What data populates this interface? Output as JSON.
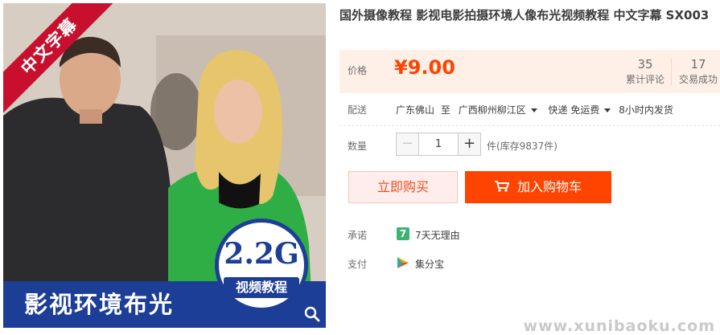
{
  "product": {
    "title": "国外摄像教程 影视电影拍摄环境人像布光视频教程 中文字幕 SX003",
    "image": {
      "ribbon_text": "中文字幕",
      "badge_size": "2.2G",
      "badge_label": "视频教程",
      "bottom_title": "影视环境布光"
    }
  },
  "price": {
    "label": "价格",
    "value": "¥9.00",
    "reviews_count": "35",
    "reviews_label": "累计评论",
    "sales_count": "17",
    "sales_label": "交易成功"
  },
  "shipping": {
    "label": "配送",
    "origin": "广东佛山",
    "to": "至",
    "destination": "广西柳州柳江区",
    "method": "快递 免运费",
    "dispatch": "8小时内发货"
  },
  "quantity": {
    "label": "数量",
    "minus": "−",
    "value": "1",
    "plus": "+",
    "stock": "件(库存9837件)"
  },
  "actions": {
    "buy_now": "立即购买",
    "add_to_cart": "加入购物车"
  },
  "promise": {
    "label": "承诺",
    "icon_text": "7",
    "text": "7天无理由"
  },
  "payment": {
    "label": "支付",
    "text": "集分宝"
  },
  "watermark": "www.xunibaoku.com",
  "colors": {
    "accent": "#ff4400",
    "price": "#ff4400",
    "ribbon": "#c8102e",
    "band": "#1d3e96",
    "promise_green": "#3cb371"
  }
}
